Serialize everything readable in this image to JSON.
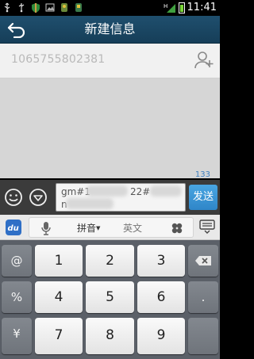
{
  "status_bar": {
    "time": "11:41",
    "network": "H",
    "icons": [
      "usb-icon",
      "usb-debug-icon",
      "shield-icon",
      "image-icon",
      "app-icon",
      "app-icon-2",
      "signal-icon",
      "battery-icon"
    ]
  },
  "title_bar": {
    "title": "新建信息",
    "back_icon": "back-arrow-icon"
  },
  "recipient": {
    "value": "1065755802381",
    "add_contact_icon": "add-contact-icon"
  },
  "compose": {
    "char_count": "133",
    "message_prefix": "gm#1",
    "message_middle": "22#",
    "message_line2": "n",
    "send_label": "发送",
    "emoji_icon": "emoji-icon",
    "expand_icon": "expand-down-icon"
  },
  "ime_toolbar": {
    "logo_text": "du",
    "mic_icon": "microphone-icon",
    "pinyin_label": "拼音",
    "english_label": "英文",
    "clover_icon": "clover-icon",
    "hide_icon": "keyboard-hide-icon"
  },
  "keyboard": {
    "rows": [
      [
        "@",
        "1",
        "2",
        "3",
        "⌫"
      ],
      [
        "%",
        "4",
        "5",
        "6",
        "."
      ],
      [
        "¥",
        "7",
        "8",
        "9",
        ""
      ]
    ]
  },
  "colors": {
    "title_bar": "#1f4f6e",
    "send_button": "#3a93d6",
    "char_count": "#3f7fbf",
    "thread_bg": "#d6d6d6"
  }
}
